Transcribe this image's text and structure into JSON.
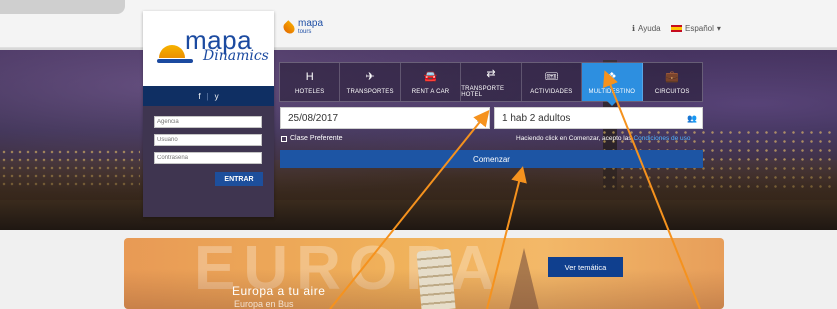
{
  "header": {
    "brand": {
      "name": "mapa",
      "sub": "tours"
    },
    "help_label": "Ayuda",
    "help_icon": "info-icon",
    "language_label": "Español",
    "language_icon": "spain-flag-icon"
  },
  "login": {
    "logo": {
      "line1": "mapa",
      "line2": "Dinamics"
    },
    "social": {
      "facebook": "f",
      "twitter": "y"
    },
    "agency_placeholder": "Agencia",
    "user_placeholder": "Usuario",
    "password_placeholder": "Contraseña",
    "submit_label": "ENTRAR"
  },
  "search": {
    "tabs": [
      {
        "label": "HOTELES",
        "icon": "hotel-icon",
        "glyph": "H",
        "active": false
      },
      {
        "label": "TRANSPORTES",
        "icon": "plane-icon",
        "glyph": "✈",
        "active": false
      },
      {
        "label": "RENT A CAR",
        "icon": "car-icon",
        "glyph": "🚘",
        "active": false
      },
      {
        "label": "TRANSPORTE HOTEL",
        "icon": "transfer-icon",
        "glyph": "⇄",
        "active": false
      },
      {
        "label": "ACTIVIDADES",
        "icon": "ticket-icon",
        "glyph": "🎟",
        "active": false
      },
      {
        "label": "MULTIDESTINO",
        "icon": "multidestination-icon",
        "glyph": "❖",
        "active": true
      },
      {
        "label": "CIRCUITOS",
        "icon": "suitcase-icon",
        "glyph": "💼",
        "active": false
      }
    ],
    "date_value": "25/08/2017",
    "rooms_value": "1 hab 2 adultos",
    "preferred_class_label": "Clase Preferente",
    "terms_text": "Haciendo click en Comenzar, acepto las",
    "terms_link": "Condiciones de uso",
    "submit_label": "Comenzar"
  },
  "promo": {
    "background_text": "EUROPA",
    "title": "Europa a tu aire",
    "subtitle": "Europa en Bus",
    "button_label": "Ver temática"
  },
  "colors": {
    "brand_blue": "#1b4aa0",
    "active_tab": "#2d8fe0",
    "annotation_arrow": "#f5921e"
  }
}
